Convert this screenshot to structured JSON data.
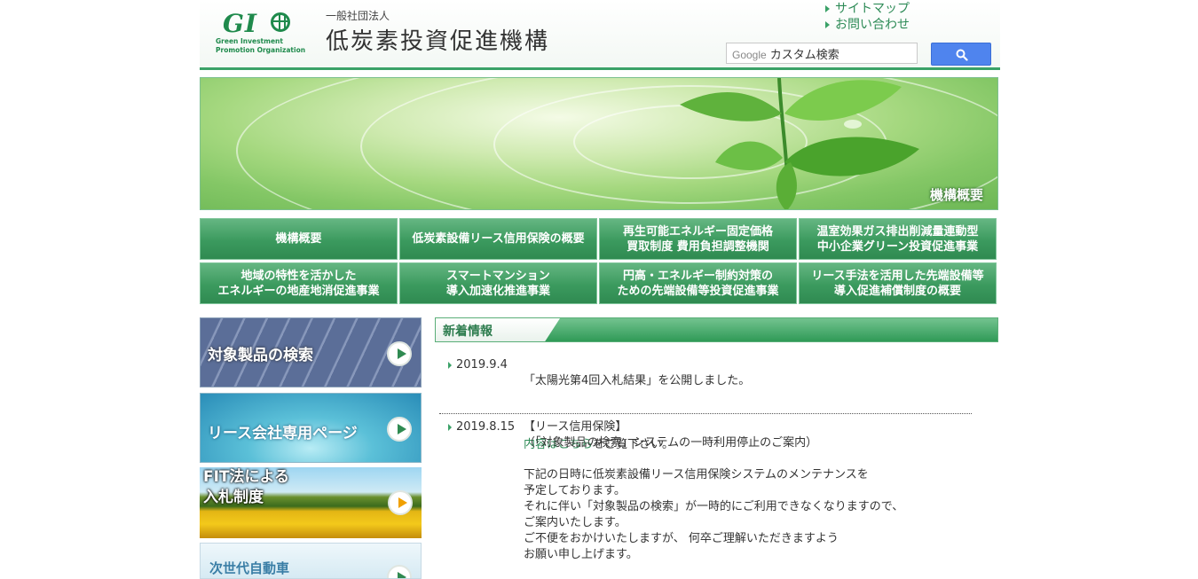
{
  "header": {
    "logo_mark": "GI",
    "logo_sub_1": "Green Investment",
    "logo_sub_2": "Promotion Organization",
    "org_sub": "一般社団法人",
    "org_name": "低炭素投資促進機構",
    "links": [
      "サイトマップ",
      "お問い合わせ"
    ],
    "search_brand": "Google",
    "search_placeholder": "カスタム検索"
  },
  "banner": {
    "label": "機構概要"
  },
  "nav": {
    "items": [
      "機構概要",
      "低炭素設備リース信用保険の概要",
      "再生可能エネルギー固定価格\n買取制度 費用負担調整機関",
      "温室効果ガス排出削減量連動型\n中小企業グリーン投資促進事業",
      "地域の特性を活かした\nエネルギーの地産地消促進事業",
      "スマートマンション\n導入加速化推進事業",
      "円高・エネルギー制約対策の\nための先端設備等投資促進事業",
      "リース手法を活用した先端設備等\n導入促進補償制度の概要"
    ]
  },
  "side": {
    "products": "対象製品の検索",
    "lease": "リース会社専用ページ",
    "fit": "FIT法による\n入札制度",
    "car": "次世代自動車"
  },
  "news": {
    "title": "新着情報",
    "entries": [
      {
        "date": "2019.9.4",
        "line1": "「太陽光第4回入札結果」を公開しました。",
        "link": "内容はこちら",
        "after_link": "をご覧下さい。"
      },
      {
        "date": "2019.8.15",
        "body": "【リース信用保険】\n（「対象製品の検索」システムの一時利用停止のご案内）\n\n下記の日時に低炭素設備リース信用保険システムのメンテナンスを\n予定しております。\nそれに伴い「対象製品の検索」が一時的にご利用できなくなりますので、\nご案内いたします。\nご不便をおかけいたしますが、 何卒ご理解いただきますよう\nお願い申し上げます。"
      }
    ]
  },
  "colors": {
    "accent": "#2f8a51",
    "link": "#2e8b57",
    "search": "#4f84ee"
  }
}
